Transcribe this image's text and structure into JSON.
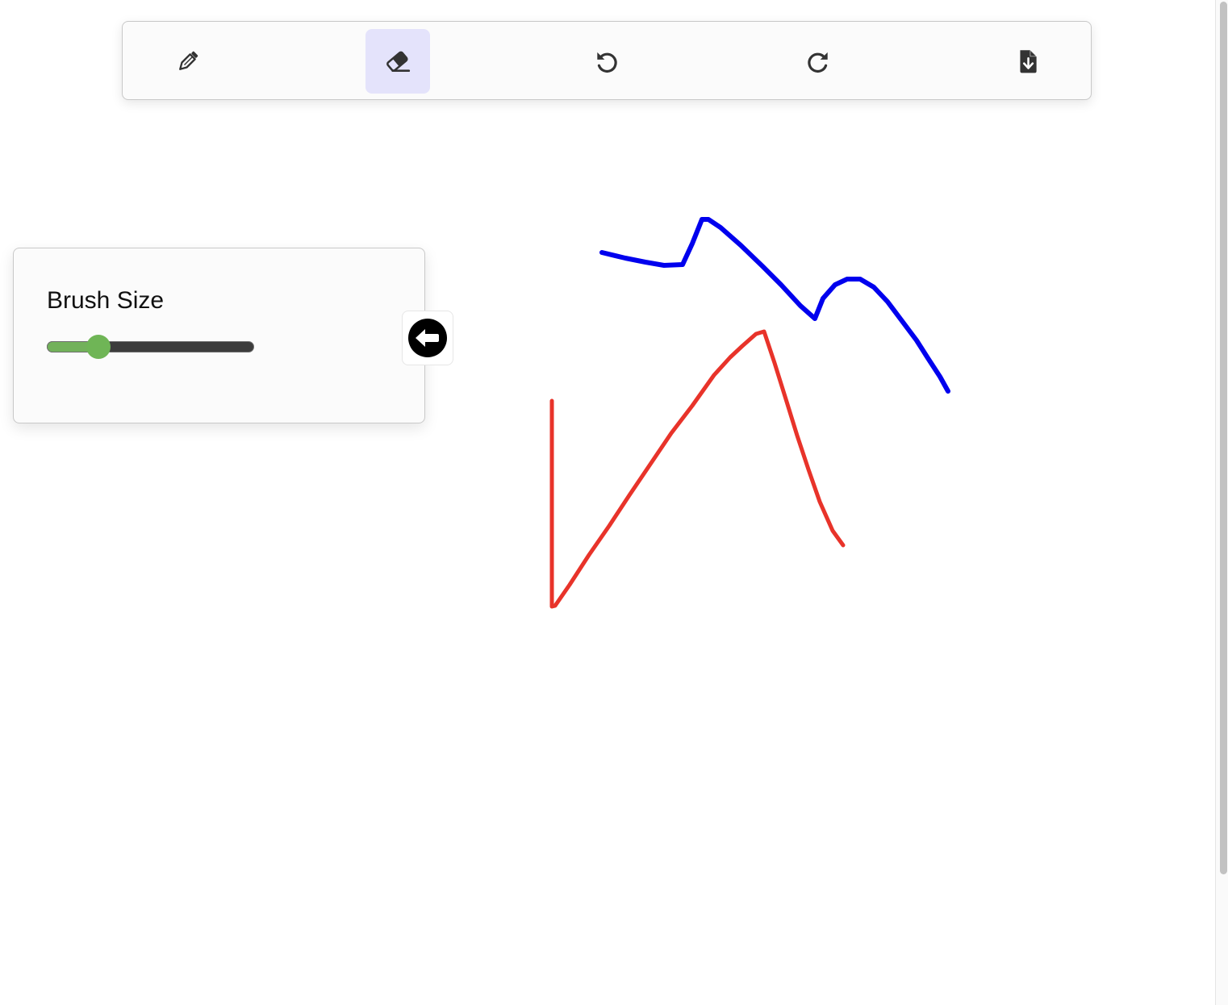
{
  "toolbar": {
    "tools": [
      {
        "id": "pencil",
        "icon": "pencil-icon",
        "active": false
      },
      {
        "id": "eraser",
        "icon": "eraser-icon",
        "active": true
      },
      {
        "id": "undo",
        "icon": "undo-icon",
        "active": false
      },
      {
        "id": "redo",
        "icon": "redo-icon",
        "active": false
      },
      {
        "id": "download",
        "icon": "file-download-icon",
        "active": false
      }
    ],
    "active_highlight_color": "#e4e3fb",
    "icon_color": "#333333"
  },
  "brush_panel": {
    "title": "Brush Size",
    "slider_level": 0.25,
    "slider_fill_color": "#72b15a",
    "slider_track_color": "#3c3c3c",
    "collapse_icon": "arrow-left-circle-icon"
  },
  "canvas": {
    "strokes": [
      {
        "name": "blue-stroke",
        "color": "#0000ee"
      },
      {
        "name": "red-stroke",
        "color": "#e8332a"
      }
    ]
  },
  "scrollbar": {
    "thumb_color": "#c2c2c2"
  }
}
